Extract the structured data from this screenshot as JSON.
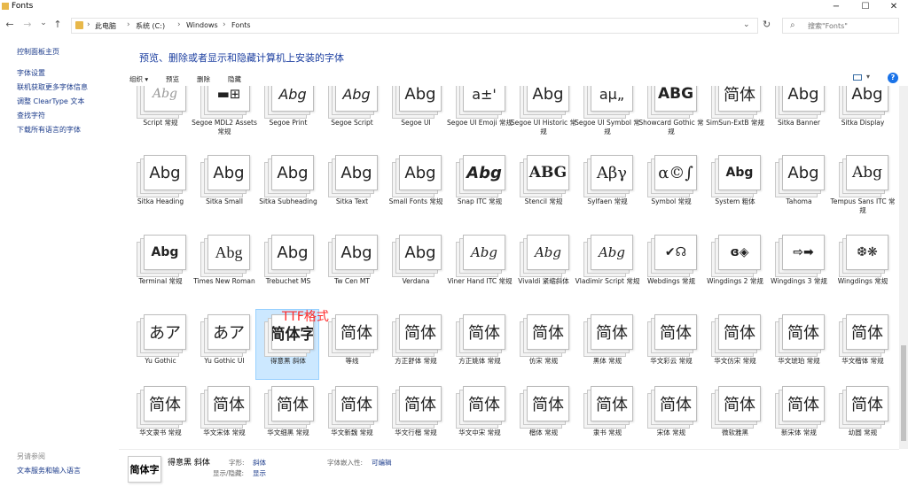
{
  "window": {
    "title": "Fonts",
    "minimize": "−",
    "maximize": "☐",
    "close": "✕"
  },
  "nav": {
    "back": "←",
    "forward": "→",
    "dropdown": "⌄",
    "up": "↑"
  },
  "breadcrumb": {
    "items": [
      "此电脑",
      "系统 (C:)",
      "Windows",
      "Fonts"
    ]
  },
  "search": {
    "placeholder": "搜索\"Fonts\""
  },
  "sidebar": {
    "items": [
      "控制面板主页",
      "字体设置",
      "联机获取更多字体信息",
      "调整 ClearType 文本",
      "查找字符",
      "下载所有语言的字体"
    ],
    "see_also": "另请参阅",
    "see_also_items": [
      "文本服务和输入语言"
    ]
  },
  "heading": "预览、删除或者显示和隐藏计算机上安装的字体",
  "toolbar": {
    "organize": "组织 ▾",
    "preview": "预览",
    "delete": "删除",
    "hide": "隐藏"
  },
  "annotation": {
    "text": "TTF格式",
    "color": "#ff2a2a"
  },
  "fonts": [
    {
      "sample": "Abg",
      "name": "Script 常规"
    },
    {
      "sample": "▬⊞",
      "name": "Segoe MDL2 Assets 常规"
    },
    {
      "sample": "Abg",
      "name": "Segoe Print"
    },
    {
      "sample": "Abg",
      "name": "Segoe Script"
    },
    {
      "sample": "Abg",
      "name": "Segoe UI"
    },
    {
      "sample": "a±'",
      "name": "Segoe UI Emoji 常规"
    },
    {
      "sample": "Abg",
      "name": "Segoe UI Historic 常规"
    },
    {
      "sample": "aμ„",
      "name": "Segoe UI Symbol 常规"
    },
    {
      "sample": "ABG",
      "name": "Showcard Gothic 常规"
    },
    {
      "sample": "简体",
      "name": "SimSun-ExtB 常规"
    },
    {
      "sample": "Abg",
      "name": "Sitka Banner"
    },
    {
      "sample": "Abg",
      "name": "Sitka Display"
    },
    {
      "sample": "Abg",
      "name": "Sitka Heading"
    },
    {
      "sample": "Abg",
      "name": "Sitka Small"
    },
    {
      "sample": "Abg",
      "name": "Sitka Subheading"
    },
    {
      "sample": "Abg",
      "name": "Sitka Text"
    },
    {
      "sample": "Abg",
      "name": "Small Fonts 常规"
    },
    {
      "sample": "Abg",
      "name": "Snap ITC 常规"
    },
    {
      "sample": "ABG",
      "name": "Stencil 常规"
    },
    {
      "sample": "Αβγ",
      "name": "Sylfaen 常规"
    },
    {
      "sample": "α©∫",
      "name": "Symbol 常规"
    },
    {
      "sample": "Abg",
      "name": "System 粗体"
    },
    {
      "sample": "Abg",
      "name": "Tahoma"
    },
    {
      "sample": "Abg",
      "name": "Tempus Sans ITC 常规"
    },
    {
      "sample": "Abg",
      "name": "Terminal 常规"
    },
    {
      "sample": "Abg",
      "name": "Times New Roman"
    },
    {
      "sample": "Abg",
      "name": "Trebuchet MS"
    },
    {
      "sample": "Abg",
      "name": "Tw Cen MT"
    },
    {
      "sample": "Abg",
      "name": "Verdana"
    },
    {
      "sample": "Abg",
      "name": "Viner Hand ITC 常规"
    },
    {
      "sample": "Abg",
      "name": "Vivaldi 紧缩斜体"
    },
    {
      "sample": "Abg",
      "name": "Vladimir Script 常规"
    },
    {
      "sample": "✔☊",
      "name": "Webdings 常规"
    },
    {
      "sample": "ɞ◈",
      "name": "Wingdings 2 常规"
    },
    {
      "sample": "⇨➡",
      "name": "Wingdings 3 常规"
    },
    {
      "sample": "❆❋",
      "name": "Wingdings 常规"
    },
    {
      "sample": "あア",
      "name": "Yu Gothic"
    },
    {
      "sample": "あア",
      "name": "Yu Gothic UI"
    },
    {
      "sample": "简体字",
      "name": "得意黑 斜体"
    },
    {
      "sample": "简体",
      "name": "等线"
    },
    {
      "sample": "简体",
      "name": "方正舒体 常规"
    },
    {
      "sample": "简体",
      "name": "方正姚体 常规"
    },
    {
      "sample": "简体",
      "name": "仿宋 常规"
    },
    {
      "sample": "简体",
      "name": "黑体 常规"
    },
    {
      "sample": "简体",
      "name": "华文彩云 常规"
    },
    {
      "sample": "简体",
      "name": "华文仿宋 常规"
    },
    {
      "sample": "简体",
      "name": "华文琥珀 常规"
    },
    {
      "sample": "简体",
      "name": "华文楷体 常规"
    },
    {
      "sample": "简体",
      "name": "华文隶书 常规"
    },
    {
      "sample": "简体",
      "name": "华文宋体 常规"
    },
    {
      "sample": "简体",
      "name": "华文细黑 常规"
    },
    {
      "sample": "简体",
      "name": "华文新魏 常规"
    },
    {
      "sample": "简体",
      "name": "华文行楷 常规"
    },
    {
      "sample": "简体",
      "name": "华文中宋 常规"
    },
    {
      "sample": "简体",
      "name": "楷体 常规"
    },
    {
      "sample": "简体",
      "name": "隶书 常规"
    },
    {
      "sample": "简体",
      "name": "宋体 常规"
    },
    {
      "sample": "简体",
      "name": "微软雅黑"
    },
    {
      "sample": "简体",
      "name": "新宋体 常规"
    },
    {
      "sample": "简体",
      "name": "幼圆 常规"
    }
  ],
  "details": {
    "sample": "简体字",
    "name": "得意黑 斜体",
    "style_label": "字形:",
    "style_value": "斜体",
    "show_label": "显示/隐藏:",
    "show_value": "显示",
    "embed_label": "字体嵌入性:",
    "embed_value": "可编辑"
  }
}
